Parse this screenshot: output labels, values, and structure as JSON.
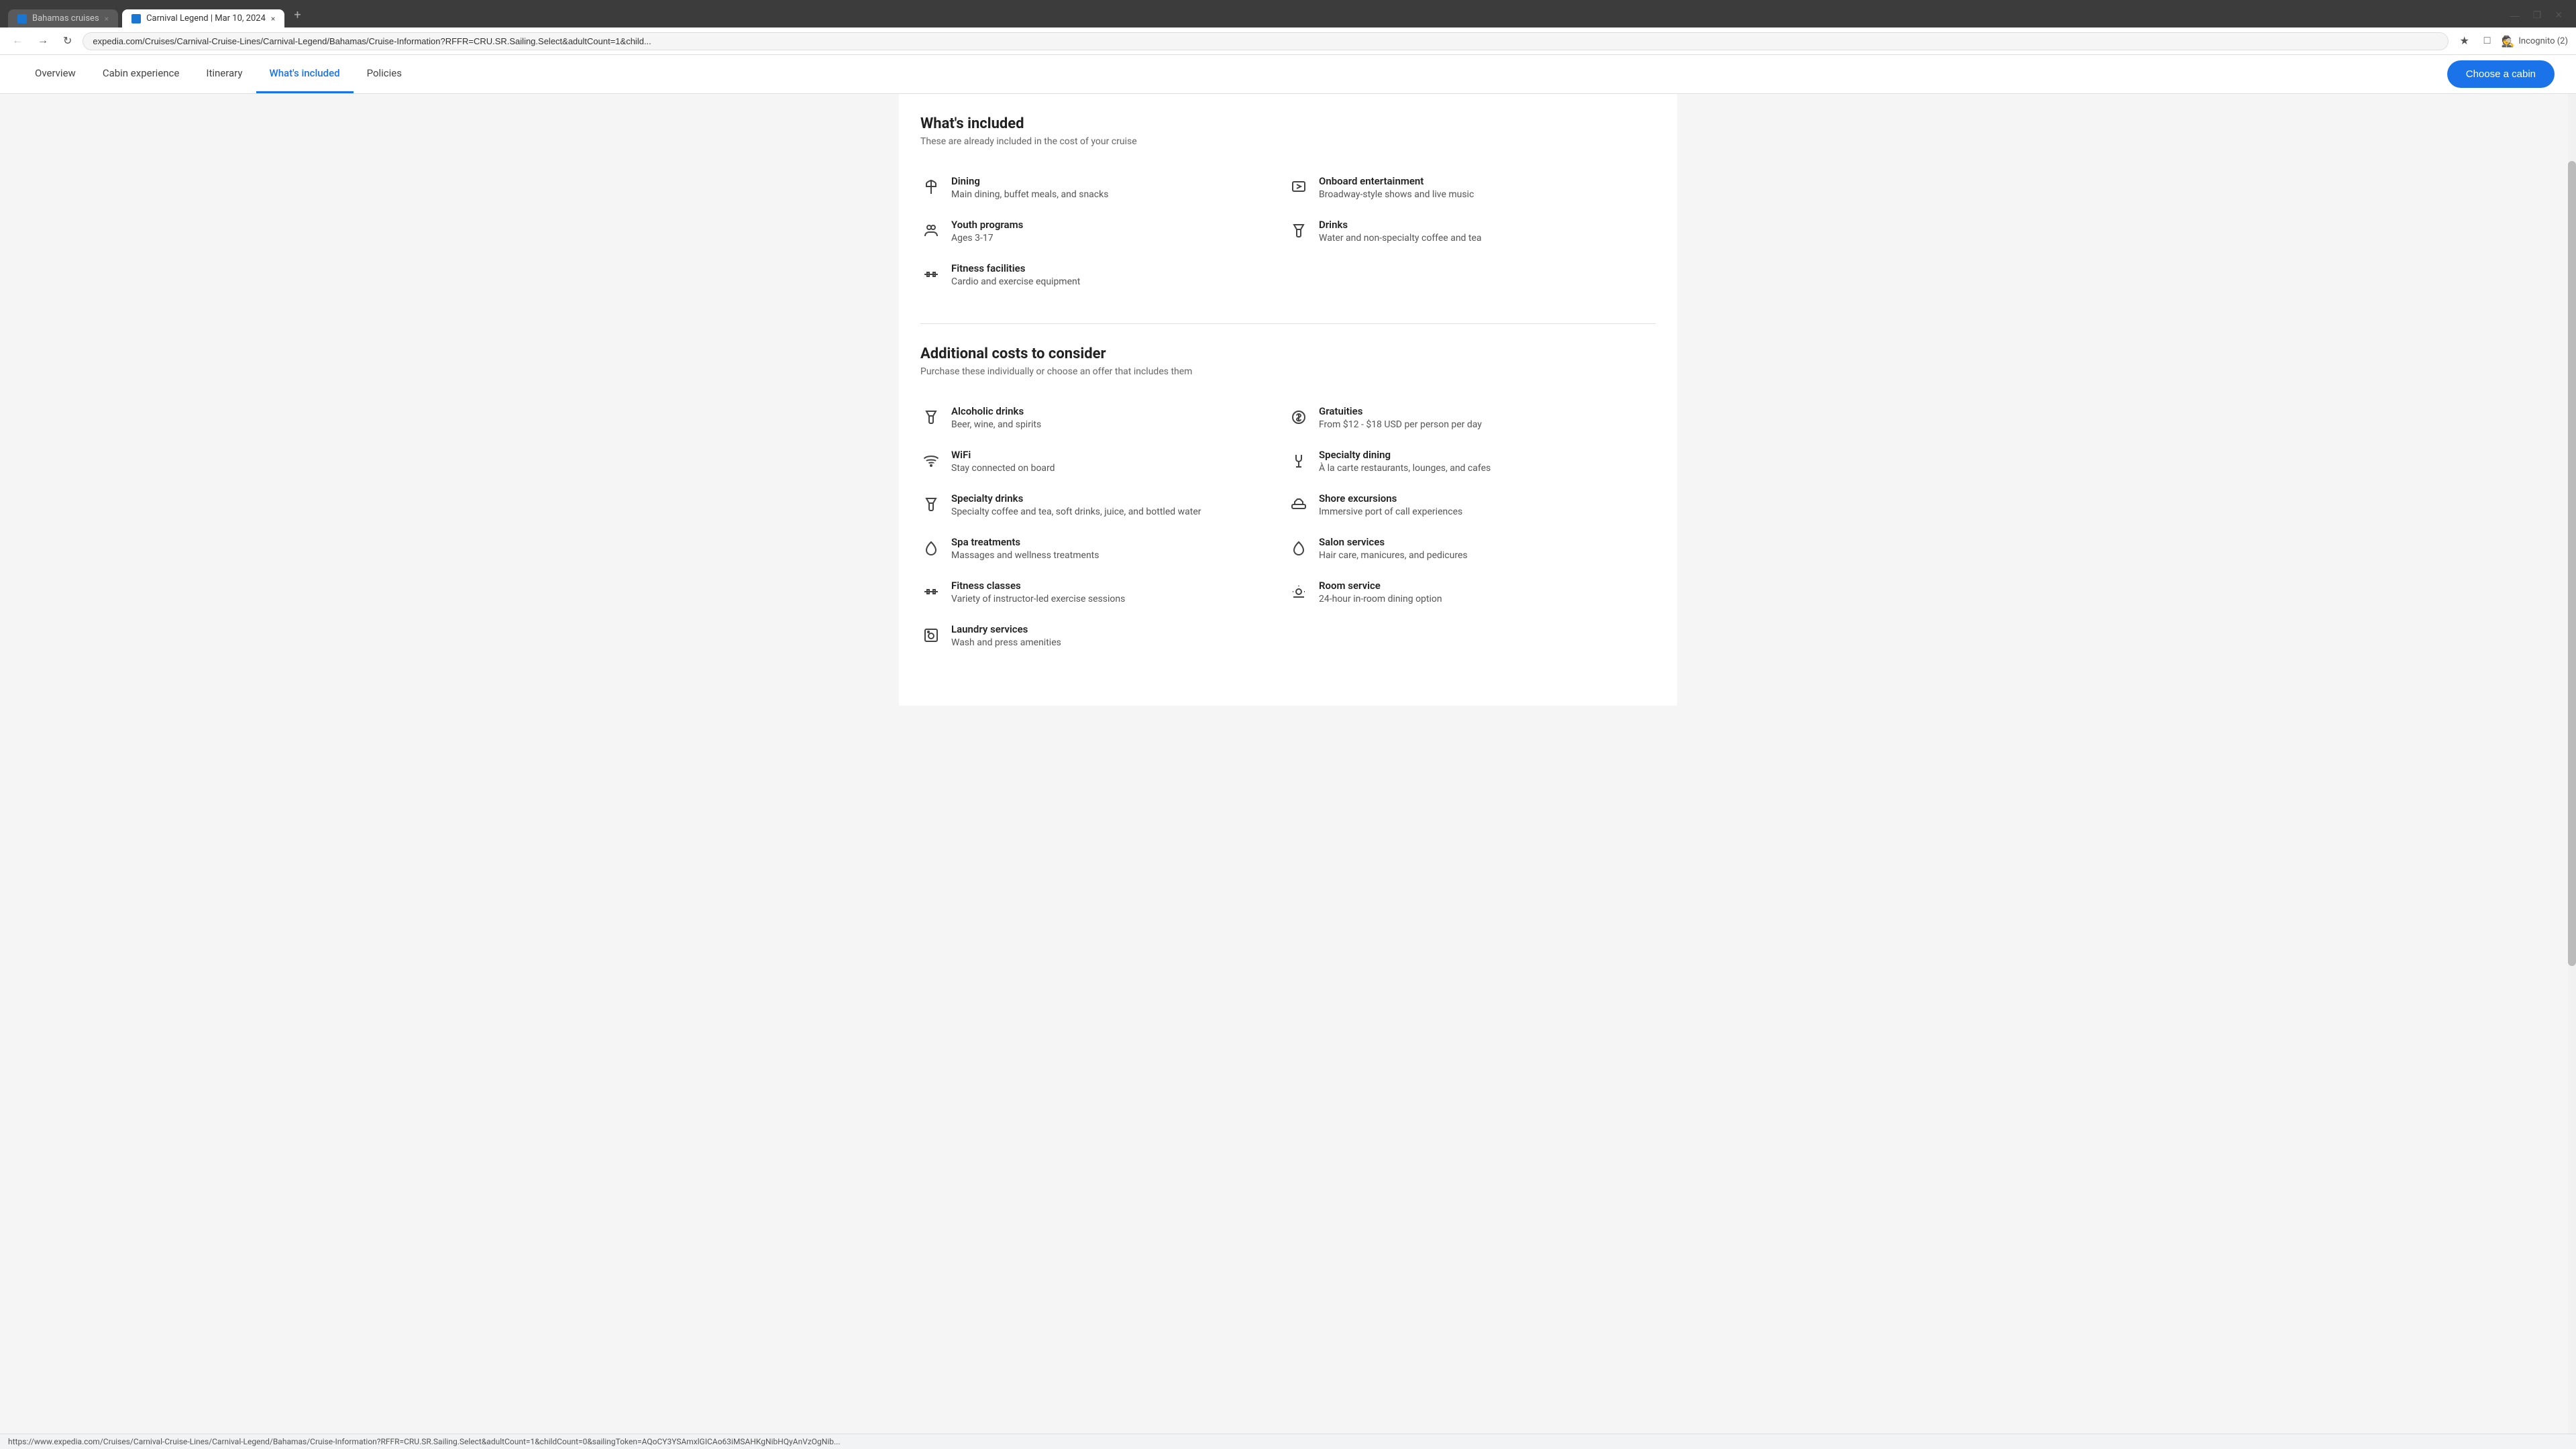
{
  "browser": {
    "tabs": [
      {
        "label": "Bahamas cruises",
        "active": false,
        "close": "×"
      },
      {
        "label": "Carnival Legend | Mar 10, 2024",
        "active": true,
        "close": "×"
      }
    ],
    "new_tab": "+",
    "address": "expedia.com/Cruises/Carnival-Cruise-Lines/Carnival-Legend/Bahamas/Cruise-Information?RFFR=CRU.SR.Sailing.Select&adultCount=1&child...",
    "incognito": "Incognito (2)",
    "window_minimize": "—",
    "window_restore": "❐",
    "window_close": "✕"
  },
  "nav": {
    "items": [
      {
        "label": "Overview",
        "active": false
      },
      {
        "label": "Cabin experience",
        "active": false
      },
      {
        "label": "Itinerary",
        "active": false
      },
      {
        "label": "What's included",
        "active": true
      },
      {
        "label": "Policies",
        "active": false
      }
    ],
    "cta": "Choose a cabin"
  },
  "whats_included": {
    "title": "What's included",
    "subtitle": "These are already included in the cost of your cruise",
    "items": [
      {
        "icon": "✦",
        "icon_type": "dining",
        "name": "Dining",
        "desc": "Main dining, buffet meals, and snacks",
        "column": 0
      },
      {
        "icon": "🎭",
        "icon_type": "entertainment",
        "name": "Onboard entertainment",
        "desc": "Broadway-style shows and live music",
        "column": 1
      },
      {
        "icon": "👥",
        "icon_type": "youth",
        "name": "Youth programs",
        "desc": "Ages 3-17",
        "column": 0
      },
      {
        "icon": "🍹",
        "icon_type": "drinks",
        "name": "Drinks",
        "desc": "Water and non-specialty coffee and tea",
        "column": 1
      },
      {
        "icon": "🏋",
        "icon_type": "fitness",
        "name": "Fitness facilities",
        "desc": "Cardio and exercise equipment",
        "column": 0
      }
    ]
  },
  "additional_costs": {
    "title": "Additional costs to consider",
    "subtitle": "Purchase these individually or choose an offer that includes them",
    "items": [
      {
        "icon_type": "drinks-alt",
        "name": "Alcoholic drinks",
        "desc": "Beer, wine, and spirits",
        "column": 0
      },
      {
        "icon_type": "gratuities",
        "name": "Gratuities",
        "desc": "From $12 - $18 USD per person per day",
        "column": 1
      },
      {
        "icon_type": "wifi",
        "name": "WiFi",
        "desc": "Stay connected on board",
        "column": 0
      },
      {
        "icon_type": "specialty-dining",
        "name": "Specialty dining",
        "desc": "À la carte restaurants, lounges, and cafes",
        "column": 1
      },
      {
        "icon_type": "specialty-drinks",
        "name": "Specialty drinks",
        "desc": "Specialty coffee and tea, soft drinks, juice, and bottled water",
        "column": 0
      },
      {
        "icon_type": "shore",
        "name": "Shore excursions",
        "desc": "Immersive port of call experiences",
        "column": 1
      },
      {
        "icon_type": "spa",
        "name": "Spa treatments",
        "desc": "Massages and wellness treatments",
        "column": 0
      },
      {
        "icon_type": "salon",
        "name": "Salon services",
        "desc": "Hair care, manicures, and pedicures",
        "column": 1
      },
      {
        "icon_type": "fitness-classes",
        "name": "Fitness classes",
        "desc": "Variety of instructor-led exercise sessions",
        "column": 0
      },
      {
        "icon_type": "room-service",
        "name": "Room service",
        "desc": "24-hour in-room dining option",
        "column": 1
      },
      {
        "icon_type": "laundry",
        "name": "Laundry services",
        "desc": "Wash and press amenities",
        "column": 0
      }
    ]
  },
  "status_bar": {
    "url": "https://www.expedia.com/Cruises/Carnival-Cruise-Lines/Carnival-Legend/Bahamas/Cruise-Information?RFFR=CRU.SR.Sailing.Select&adultCount=1&childCount=0&sailingToken=AQoCY3YSAmxlGICAo63iMSAHKgNibHQyAnVzOgNib..."
  }
}
